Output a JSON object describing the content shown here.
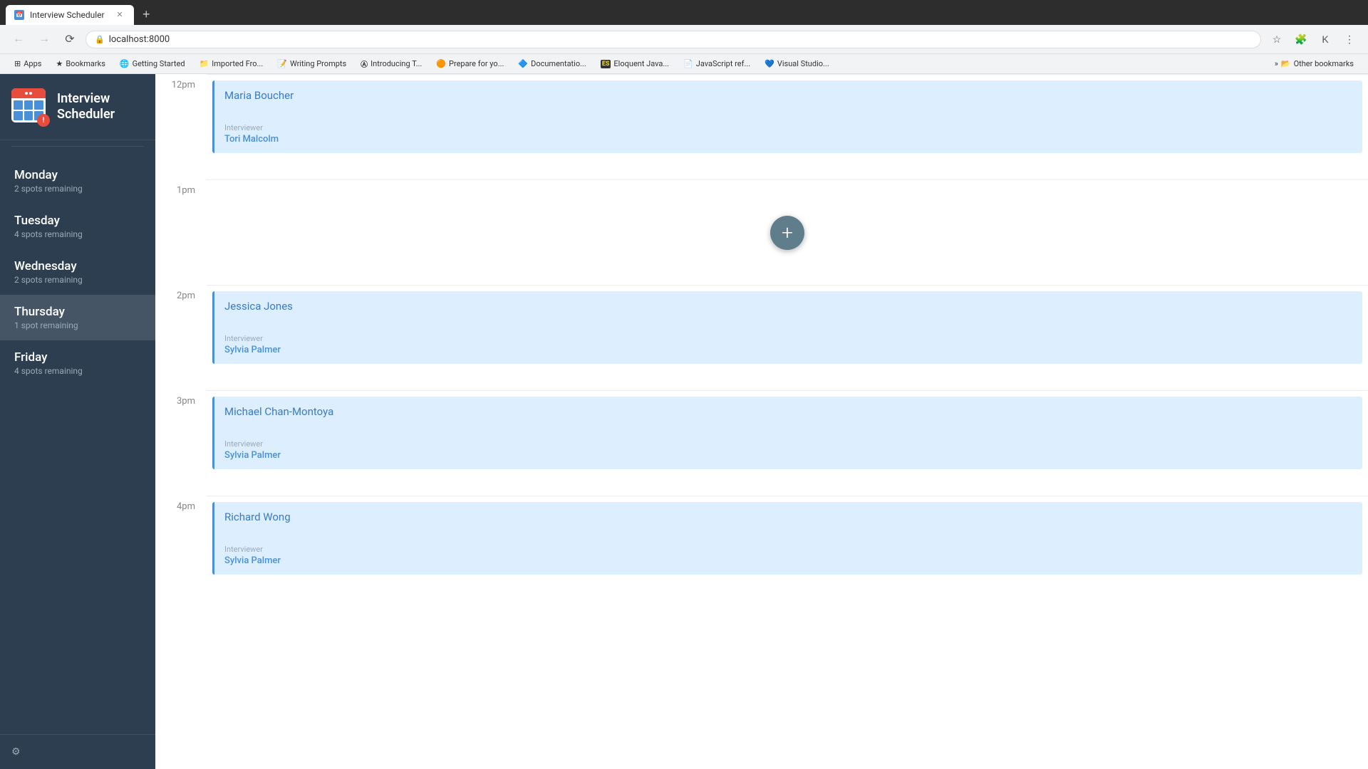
{
  "browser": {
    "tab": {
      "title": "Interview Scheduler",
      "favicon": "📅"
    },
    "url": "localhost:8000",
    "bookmarks": [
      {
        "label": "Apps",
        "icon": "⊞"
      },
      {
        "label": "Bookmarks",
        "icon": "★"
      },
      {
        "label": "Getting Started",
        "icon": "🌐"
      },
      {
        "label": "Imported Fro...",
        "icon": "📁"
      },
      {
        "label": "Writing Prompts",
        "icon": "📝"
      },
      {
        "label": "Introducing T...",
        "icon": "Ⓐ"
      },
      {
        "label": "Prepare for yo...",
        "icon": "🟠"
      },
      {
        "label": "Documentatio...",
        "icon": "🔷"
      },
      {
        "label": "Eloquent Java...",
        "icon": "ES"
      },
      {
        "label": "JavaScript ref...",
        "icon": "📄"
      },
      {
        "label": "Visual Studio...",
        "icon": "💙"
      },
      {
        "label": "Other bookmarks",
        "icon": "📂"
      }
    ]
  },
  "sidebar": {
    "title": "Interview\nScheduler",
    "title_line1": "Interview",
    "title_line2": "Scheduler",
    "nav_items": [
      {
        "day": "Monday",
        "spots": "2 spots remaining",
        "active": false
      },
      {
        "day": "Tuesday",
        "spots": "4 spots remaining",
        "active": false
      },
      {
        "day": "Wednesday",
        "spots": "2 spots remaining",
        "active": false
      },
      {
        "day": "Thursday",
        "spots": "1 spot remaining",
        "active": true
      },
      {
        "day": "Friday",
        "spots": "4 spots remaining",
        "active": false
      }
    ]
  },
  "schedule": {
    "time_slots": [
      {
        "label": "12pm",
        "appointments": [
          {
            "name": "Maria Boucher",
            "interviewer_label": "Interviewer",
            "interviewer": "Tori Malcolm"
          }
        ],
        "has_add_btn": false
      },
      {
        "label": "1pm",
        "appointments": [],
        "has_add_btn": true
      },
      {
        "label": "2pm",
        "appointments": [
          {
            "name": "Jessica Jones",
            "interviewer_label": "Interviewer",
            "interviewer": "Sylvia Palmer"
          }
        ],
        "has_add_btn": false
      },
      {
        "label": "3pm",
        "appointments": [
          {
            "name": "Michael Chan-Montoya",
            "interviewer_label": "Interviewer",
            "interviewer": "Sylvia Palmer"
          }
        ],
        "has_add_btn": false
      },
      {
        "label": "4pm",
        "appointments": [
          {
            "name": "Richard Wong",
            "interviewer_label": "Interviewer",
            "interviewer": "Sylvia Palmer"
          }
        ],
        "has_add_btn": false
      }
    ],
    "add_btn_label": "+"
  }
}
